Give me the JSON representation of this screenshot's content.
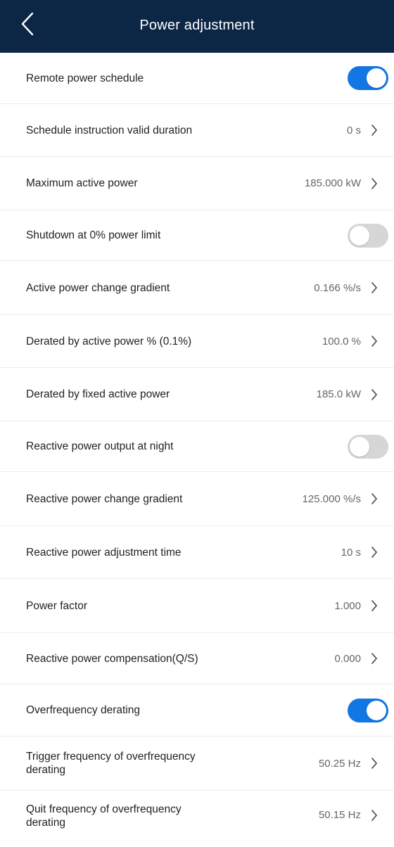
{
  "header": {
    "title": "Power adjustment"
  },
  "colors": {
    "header_bg": "#0c2646",
    "toggle_on": "#1276e4",
    "toggle_off": "#d6d6d6"
  },
  "settings": [
    {
      "label": "Remote power schedule",
      "toggle": "on"
    },
    {
      "label": "Schedule instruction valid duration",
      "value": "0 s"
    },
    {
      "label": "Maximum active power",
      "value": "185.000 kW"
    },
    {
      "label": "Shutdown at 0% power limit",
      "toggle": "off"
    },
    {
      "label": "Active power change gradient",
      "value": "0.166 %/s"
    },
    {
      "label": "Derated by active power % (0.1%)",
      "value": "100.0 %"
    },
    {
      "label": "Derated by fixed active power",
      "value": "185.0 kW"
    },
    {
      "label": "Reactive power output at night",
      "toggle": "off"
    },
    {
      "label": "Reactive power change gradient",
      "value": "125.000 %/s"
    },
    {
      "label": "Reactive power adjustment time",
      "value": "10 s"
    },
    {
      "label": "Power factor",
      "value": "1.000"
    },
    {
      "label": "Reactive power compensation(Q/S)",
      "value": "0.000"
    },
    {
      "label": "Overfrequency derating",
      "toggle": "on"
    },
    {
      "label": "Trigger frequency of overfrequency derating",
      "value": "50.25 Hz"
    },
    {
      "label": "Quit frequency of overfrequency derating",
      "value": "50.15 Hz"
    }
  ]
}
